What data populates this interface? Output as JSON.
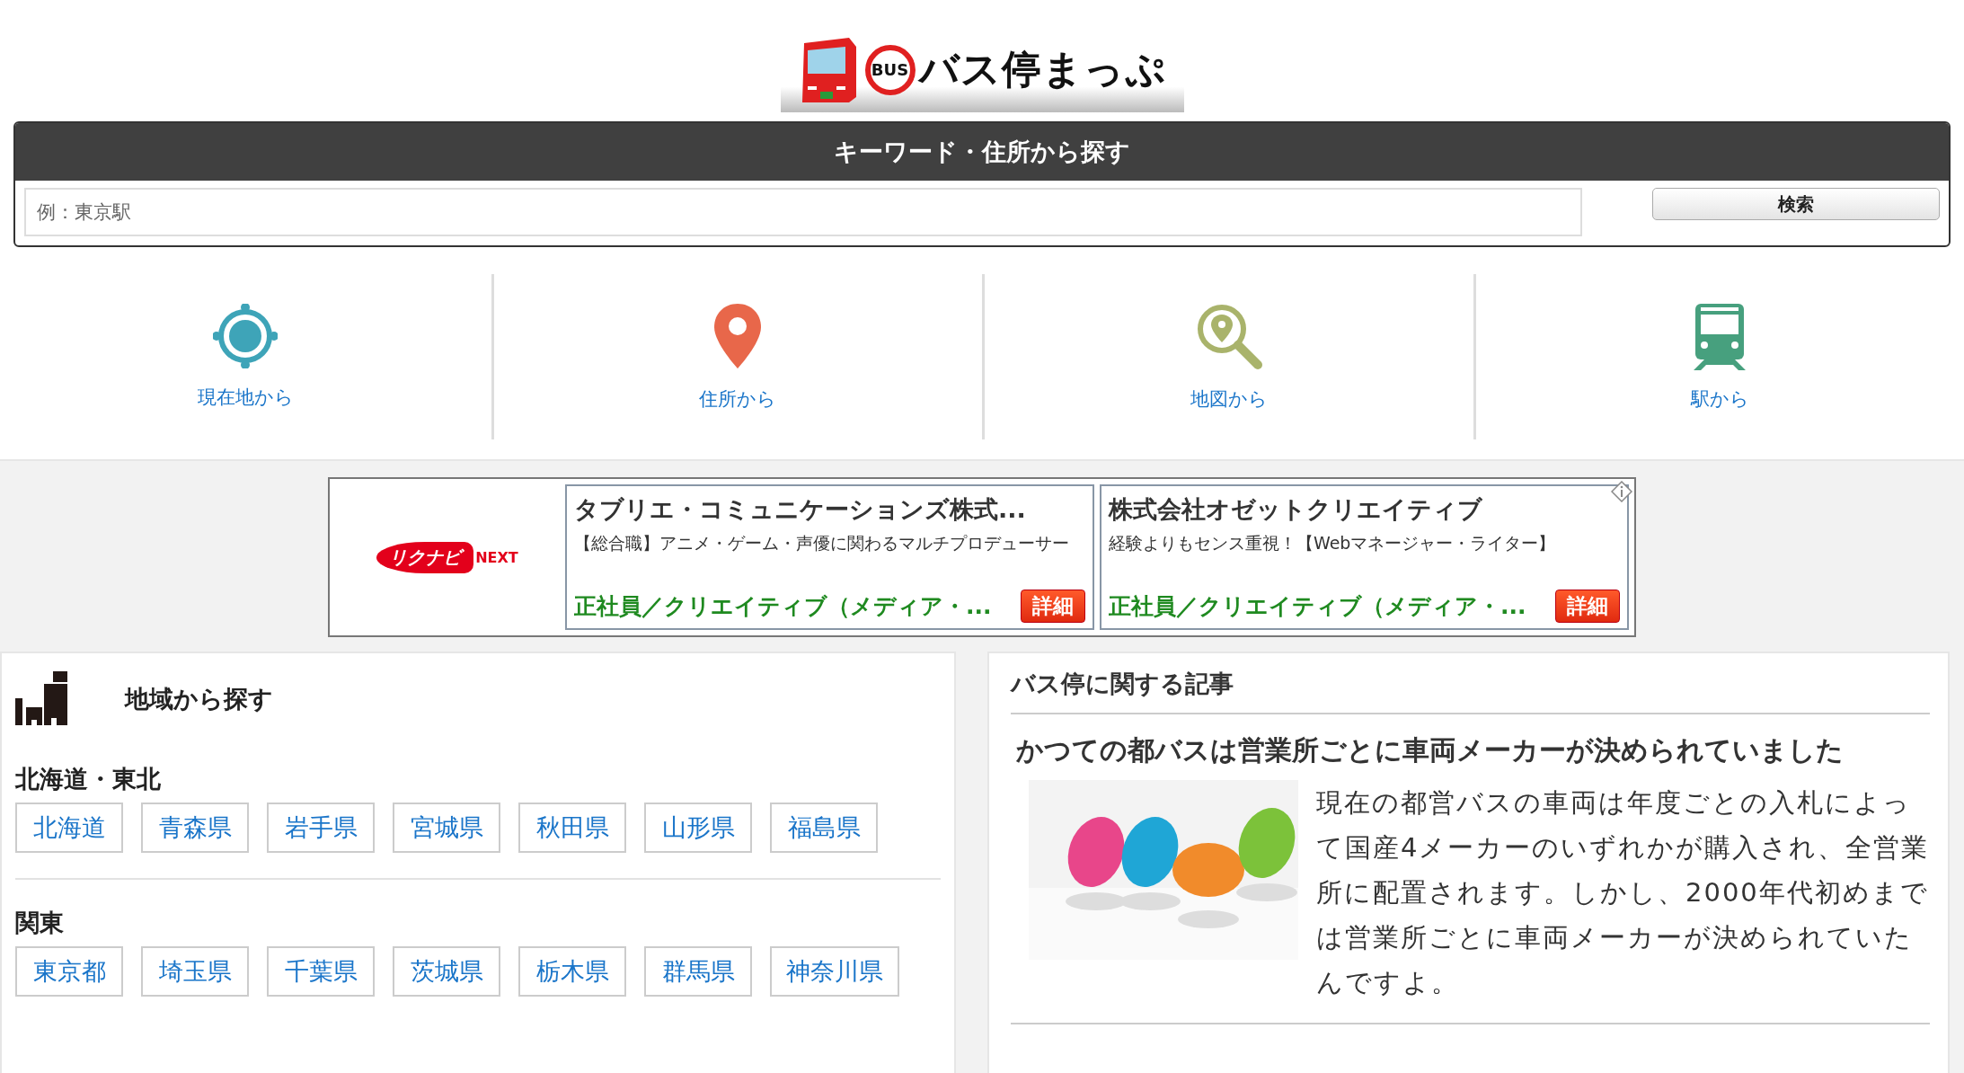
{
  "logo": {
    "badge": "BUS",
    "title": "バス停まっぷ"
  },
  "search": {
    "heading": "キーワード・住所から探す",
    "placeholder": "例：東京駅",
    "button": "検索"
  },
  "nav": [
    {
      "kind": "location",
      "label": "現在地から"
    },
    {
      "kind": "pin",
      "label": "住所から"
    },
    {
      "kind": "map",
      "label": "地図から"
    },
    {
      "kind": "train",
      "label": "駅から"
    }
  ],
  "ad": {
    "brand": "リクナビ",
    "brand_suffix": "NEXT",
    "items": [
      {
        "title": "タブリエ・コミュニケーションズ株式...",
        "description": "【総合職】アニメ・ゲーム・声優に関わるマルチプロデューサー",
        "job": "正社員／クリエイティブ（メディア・...",
        "button": "詳細"
      },
      {
        "title": "株式会社オゼットクリエイティブ",
        "description": "経験よりもセンス重視！【Webマネージャー・ライター】",
        "job": "正社員／クリエイティブ（メディア・...",
        "button": "詳細"
      }
    ]
  },
  "regions": {
    "heading": "地域から探す",
    "groups": [
      {
        "name": "北海道・東北",
        "items": [
          "北海道",
          "青森県",
          "岩手県",
          "宮城県",
          "秋田県",
          "山形県",
          "福島県"
        ]
      },
      {
        "name": "関東",
        "items": [
          "東京都",
          "埼玉県",
          "千葉県",
          "茨城県",
          "栃木県",
          "群馬県",
          "神奈川県"
        ]
      }
    ]
  },
  "articles": {
    "heading": "バス停に関する記事",
    "items": [
      {
        "title": "かつての都バスは営業所ごとに車両メーカーが決められていました",
        "body": "現在の都営バスの車両は年度ごとの入札によって国産4メーカーのいずれかが購入され、全営業所に配置されます。しかし、2000年代初めまでは営業所ごとに車両メーカーが決められていたんですよ。"
      }
    ]
  }
}
